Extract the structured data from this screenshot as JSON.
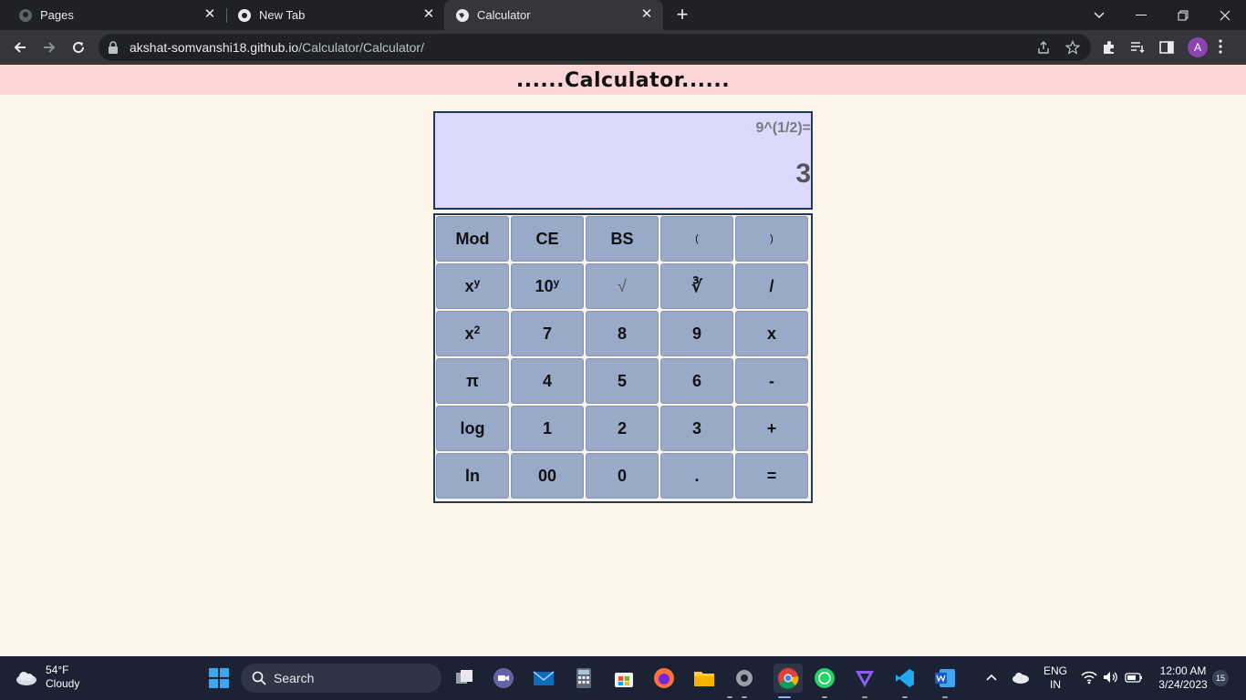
{
  "browser": {
    "tabs": [
      {
        "title": "Pages"
      },
      {
        "title": "New Tab"
      },
      {
        "title": "Calculator"
      }
    ],
    "url_host": "akshat-somvanshi18.github.io",
    "url_path": "/Calculator/Calculator/",
    "profile_initial": "A"
  },
  "page": {
    "title": "......Calculator......",
    "display": {
      "expression": "9^(1/2)=",
      "result": "3"
    },
    "keys": [
      [
        "Mod",
        "CE",
        "BS",
        "(",
        ")"
      ],
      [
        "x",
        "10",
        "√",
        "∛",
        "/"
      ],
      [
        "x",
        "7",
        "8",
        "9",
        "x"
      ],
      [
        "π",
        "4",
        "5",
        "6",
        "-"
      ],
      [
        "log",
        "1",
        "2",
        "3",
        "+"
      ],
      [
        "ln",
        "00",
        "0",
        ".",
        "="
      ]
    ],
    "superscripts": {
      "x_pow_y": "y",
      "ten_pow_y": "y",
      "x_squared": "2"
    }
  },
  "taskbar": {
    "weather_temp": "54°F",
    "weather_desc": "Cloudy",
    "search_placeholder": "Search",
    "lang_1": "ENG",
    "lang_2": "IN",
    "time": "12:00 AM",
    "date": "3/24/2023",
    "notifications": "15"
  },
  "colors": {
    "header_bg": "#fcd6d6",
    "display_bg": "#dcd9fe",
    "key_bg": "#99a9c8",
    "page_bg": "#fdf5ea"
  }
}
